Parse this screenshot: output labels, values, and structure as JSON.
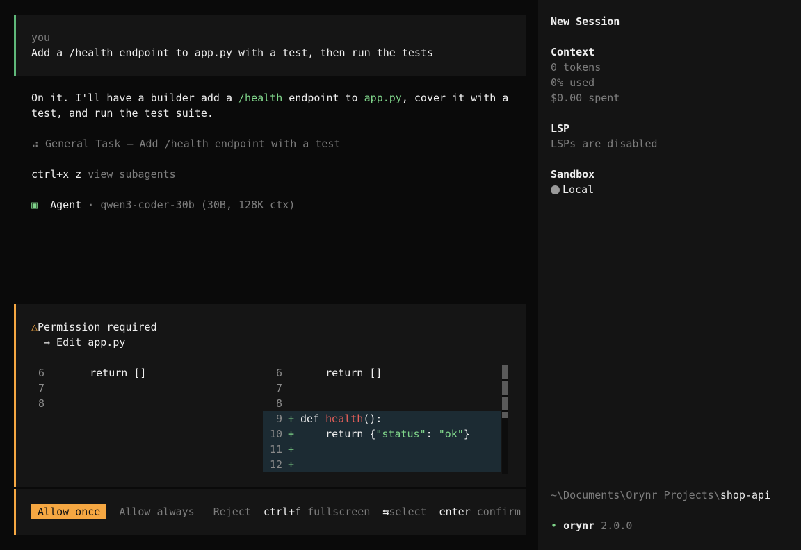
{
  "user_message": {
    "author": "you",
    "text": "Add a /health endpoint to app.py with a test, then run the tests"
  },
  "assistant": {
    "line1_a": "On it. I'll have a builder add a ",
    "line1_code1": "/health",
    "line1_b": " endpoint to ",
    "line1_code2": "app.py",
    "line1_c": ", cover it with a",
    "line2": "test, and run the test suite.",
    "task_icon": "⠴",
    "task": "General Task — Add /health endpoint with a test",
    "shortcut_key": "ctrl+x z",
    "shortcut_label": "view subagents",
    "agent_icon": "▣",
    "agent_label": "Agent",
    "agent_model": " · qwen3-coder-30b (30B, 128K ctx)"
  },
  "permission": {
    "icon": "△",
    "title": "Permission required",
    "action": "→ Edit app.py",
    "diff_left": [
      {
        "num": "6",
        "code": "    return []"
      },
      {
        "num": "7",
        "code": ""
      },
      {
        "num": "8",
        "code": ""
      }
    ],
    "diff_right": [
      {
        "num": "6",
        "code": "    return []"
      },
      {
        "num": "7",
        "code": ""
      },
      {
        "num": "8",
        "code": ""
      }
    ],
    "added_lines": {
      "l9_num": "9",
      "l9_kw": "def ",
      "l9_fn": "health",
      "l9_rest": "():",
      "l10_num": "10",
      "l10_a": "    return {",
      "l10_s1": "\"status\"",
      "l10_b": ": ",
      "l10_s2": "\"ok\"",
      "l10_c": "}",
      "l11_num": "11",
      "l12_num": "12",
      "plus": "+"
    }
  },
  "actions": {
    "allow_once": "Allow once",
    "allow_always": "Allow always",
    "reject": "Reject",
    "fullscreen_key": "ctrl+f",
    "fullscreen_label": "fullscreen",
    "select_icon": "⇆",
    "select_label": "select",
    "confirm_key": "enter",
    "confirm_label": "confirm"
  },
  "sidebar": {
    "title": "New Session",
    "context_heading": "Context",
    "tokens": "0 tokens",
    "used": "0% used",
    "spent": "$0.00 spent",
    "lsp_heading": "LSP",
    "lsp_status": "LSPs are disabled",
    "sandbox_heading": "Sandbox",
    "sandbox_value": "Local",
    "path_prefix": "~\\Documents\\Orynr_Projects\\",
    "path_project": "shop-api",
    "app_dot": "•",
    "app_name": "orynr",
    "app_version": "2.0.0"
  },
  "colors": {
    "accent_green": "#5fb87a",
    "accent_orange": "#f5a742",
    "diff_added_bg": "#1c2b33"
  }
}
